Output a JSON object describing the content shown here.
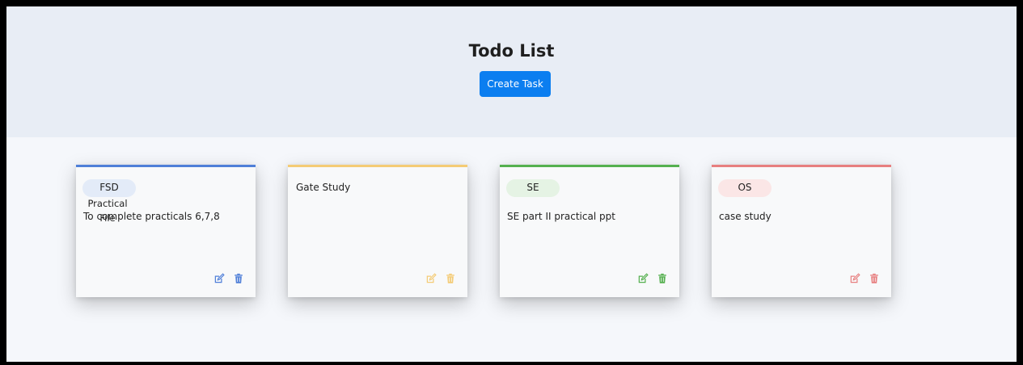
{
  "header": {
    "title": "Todo List",
    "create_label": "Create Task"
  },
  "cards": [
    {
      "category": "FSD",
      "title": "Practical",
      "overlap_text": "File",
      "description": "To complete practicals 6,7,8",
      "color": "#4f7fd8",
      "pill_bg": "#e3ebf8"
    },
    {
      "category": "",
      "title": "Gate Study",
      "description": "",
      "color": "#f4cb75",
      "pill_bg": "#fbf0dc"
    },
    {
      "category": "SE",
      "title": "",
      "description": "SE part II practical ppt",
      "color": "#55b04f",
      "pill_bg": "#e5f3e4"
    },
    {
      "category": "OS",
      "title": "",
      "description": "case study",
      "color": "#e77f7f",
      "pill_bg": "#fbe6e6"
    }
  ],
  "icons": {
    "edit": "edit-icon",
    "delete": "trash-icon"
  }
}
